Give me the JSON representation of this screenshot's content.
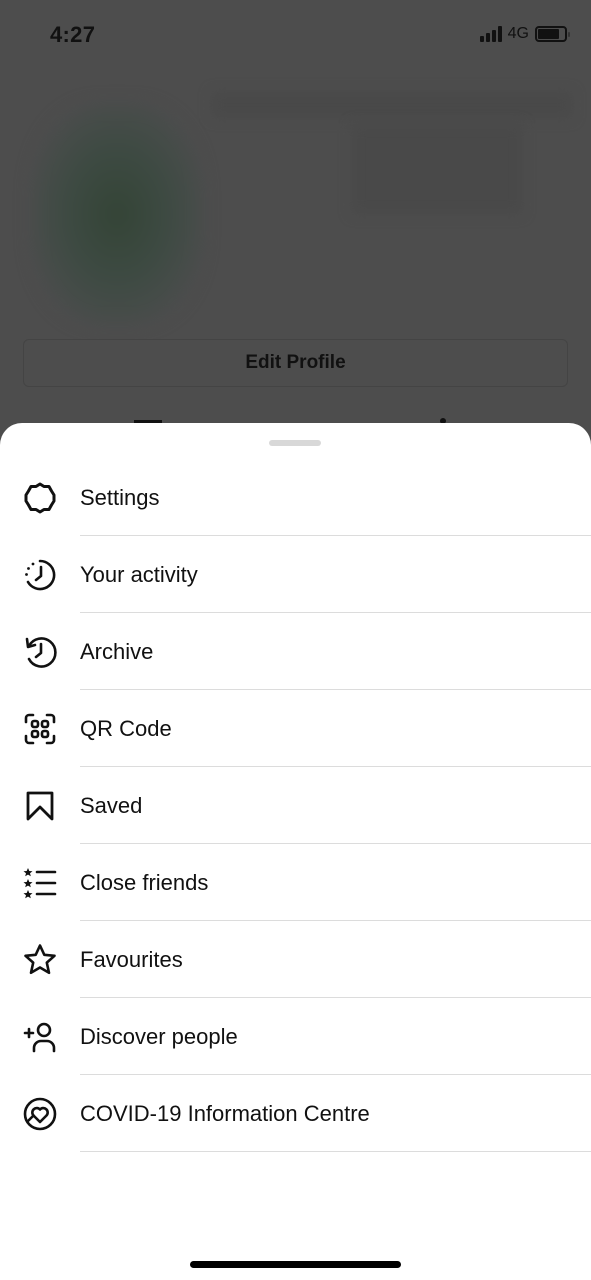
{
  "status_bar": {
    "time": "4:27",
    "network": "4G",
    "signal_bars": 4,
    "battery_level": 0.8
  },
  "background": {
    "edit_profile_label": "Edit Profile"
  },
  "menu": {
    "items": [
      {
        "label": "Settings",
        "icon": "settings-gear-icon"
      },
      {
        "label": "Your activity",
        "icon": "activity-clock-icon"
      },
      {
        "label": "Archive",
        "icon": "archive-history-icon"
      },
      {
        "label": "QR Code",
        "icon": "qr-code-icon"
      },
      {
        "label": "Saved",
        "icon": "bookmark-icon"
      },
      {
        "label": "Close friends",
        "icon": "close-friends-list-icon"
      },
      {
        "label": "Favourites",
        "icon": "star-icon"
      },
      {
        "label": "Discover people",
        "icon": "add-person-icon"
      },
      {
        "label": "COVID-19 Information Centre",
        "icon": "covid-heart-icon"
      }
    ]
  }
}
